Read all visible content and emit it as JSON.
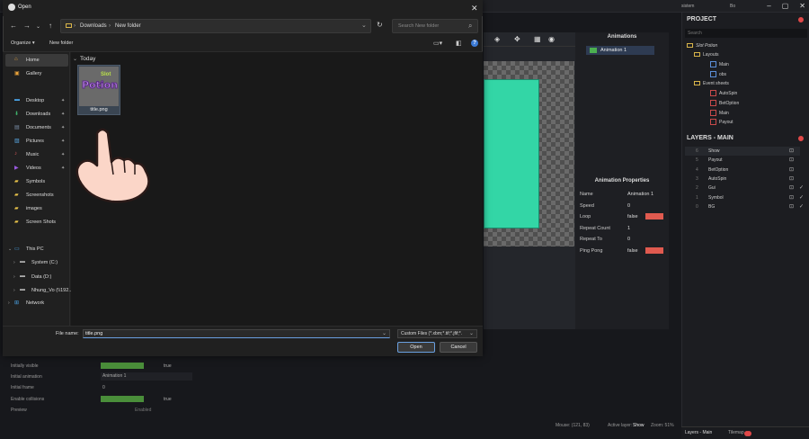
{
  "app": {
    "topbar_user": "sistem",
    "topbar_item": "Bo",
    "project": {
      "title": "PROJECT",
      "search_placeholder": "Search",
      "root": "Slot Potion",
      "layouts_folder": "Layouts",
      "layouts": [
        "Main",
        "obs"
      ],
      "events_folder": "Event sheets",
      "events": [
        "AutoSpin",
        "BetOption",
        "Main",
        "Payout"
      ]
    },
    "layers": {
      "title": "LAYERS - MAIN",
      "rows": [
        {
          "n": "6",
          "label": "Show"
        },
        {
          "n": "5",
          "label": "Payout"
        },
        {
          "n": "4",
          "label": "BetOption"
        },
        {
          "n": "3",
          "label": "AutoSpin"
        },
        {
          "n": "2",
          "label": "Gui"
        },
        {
          "n": "1",
          "label": "Symbol"
        },
        {
          "n": "0",
          "label": "BG"
        }
      ],
      "tab_main": "Layers - Main",
      "tab_tilemap": "Tilemap"
    },
    "animations": {
      "title": "Animations",
      "item": "Animation 1"
    },
    "animation_properties": {
      "title": "Animation Properties",
      "rows": [
        {
          "k": "Name",
          "v": "Animation 1"
        },
        {
          "k": "Speed",
          "v": "0"
        },
        {
          "k": "Loop",
          "v": "false"
        },
        {
          "k": "Repeat Count",
          "v": "1"
        },
        {
          "k": "Repeat To",
          "v": "0"
        },
        {
          "k": "Ping Pong",
          "v": "false"
        }
      ]
    },
    "bottom_props": [
      {
        "k": "Initially visible",
        "v": "true"
      },
      {
        "k": "Initial animation",
        "v": "Animation 1"
      },
      {
        "k": "Initial frame",
        "v": "0"
      },
      {
        "k": "Enable collisions",
        "v": "true"
      },
      {
        "k": "Preview",
        "v": "Enabled"
      }
    ],
    "status": {
      "mouse": "Mouse: (121, 83)",
      "active_layer_label": "Active layer:",
      "active_layer": "Show",
      "zoom": "Zoom: 51%"
    }
  },
  "dialog": {
    "title": "Open",
    "breadcrumb": [
      "Downloads",
      "New folder"
    ],
    "search_placeholder": "Search New folder",
    "organize": "Organize",
    "new_folder": "New folder",
    "help": "?",
    "sidebar": {
      "quick": [
        {
          "label": "Home",
          "icon": "home-icon",
          "glyph": "⌂",
          "selected": true
        },
        {
          "label": "Gallery",
          "icon": "gallery-icon",
          "glyph": "▣"
        }
      ],
      "pinned": [
        {
          "label": "Desktop",
          "icon": "desktop-icon",
          "glyph": "▬"
        },
        {
          "label": "Downloads",
          "icon": "downloads-icon",
          "glyph": "⬇"
        },
        {
          "label": "Documents",
          "icon": "documents-icon",
          "glyph": "▤"
        },
        {
          "label": "Pictures",
          "icon": "pictures-icon",
          "glyph": "▨"
        },
        {
          "label": "Music",
          "icon": "music-icon",
          "glyph": "♪"
        },
        {
          "label": "Videos",
          "icon": "videos-icon",
          "glyph": "▶"
        },
        {
          "label": "Symbols",
          "icon": "folder-icon",
          "glyph": "▰"
        },
        {
          "label": "Screenshots",
          "icon": "folder-icon",
          "glyph": "▰"
        },
        {
          "label": "images",
          "icon": "folder-icon",
          "glyph": "▰"
        },
        {
          "label": "Screen Shots",
          "icon": "folder-icon",
          "glyph": "▰"
        }
      ],
      "this_pc": "This PC",
      "drives": [
        "System (C:)",
        "Data (D:)",
        "Nhung_Vo (\\\\192..."
      ],
      "network": "Network"
    },
    "group_label": "Today",
    "file": {
      "name": "title.png",
      "thumb_text": "Potion",
      "thumb_small": "Slot"
    },
    "filename_label": "File name:",
    "filename_value": "title.png",
    "filter": "Custom Files (*.xbm;*.tif;*.jfif;*.",
    "open_label": "Open",
    "cancel_label": "Cancel"
  }
}
